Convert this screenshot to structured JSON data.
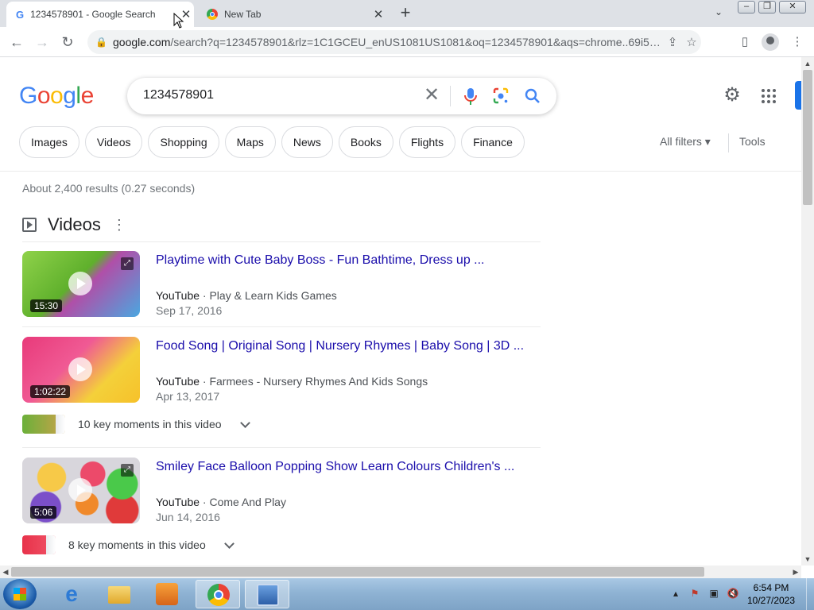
{
  "browser": {
    "tabs": [
      {
        "title": "1234578901 - Google Search",
        "active": true
      },
      {
        "title": "New Tab",
        "active": false
      }
    ],
    "url_host": "google.com",
    "url_rest": "/search?q=1234578901&rlz=1C1GCEU_enUS1081US1081&oq=1234578901&aqs=chrome..69i57j0i5..."
  },
  "search": {
    "logo": "Google",
    "query": "1234578901",
    "chips": [
      "Images",
      "Videos",
      "Shopping",
      "Maps",
      "News",
      "Books",
      "Flights",
      "Finance"
    ],
    "all_filters": "All filters ▾",
    "tools": "Tools",
    "stats": "About 2,400 results (0.27 seconds)"
  },
  "videos": {
    "heading": "Videos",
    "items": [
      {
        "title": "Playtime with Cute Baby Boss - Fun Bathtime, Dress up ...",
        "source": "YouTube",
        "channel": "Play & Learn Kids Games",
        "date": "Sep 17, 2016",
        "duration": "15:30"
      },
      {
        "title": "Food Song | Original Song | Nursery Rhymes | Baby Song | 3D ...",
        "source": "YouTube",
        "channel": "Farmees - Nursery Rhymes And Kids Songs",
        "date": "Apr 13, 2017",
        "duration": "1:02:22",
        "key_moments": "10 key moments in this video"
      },
      {
        "title": "Smiley Face Balloon Popping Show Learn Colours Children's ...",
        "source": "YouTube",
        "channel": "Come And Play",
        "date": "Jun 14, 2016",
        "duration": "5:06",
        "key_moments": "8 key moments in this video"
      }
    ]
  },
  "taskbar": {
    "time": "6:54 PM",
    "date": "10/27/2023"
  },
  "colors": {
    "link": "#1a0dab",
    "google_blue": "#4285f4",
    "google_red": "#ea4335",
    "google_yellow": "#fbbc05",
    "google_green": "#34a853"
  }
}
